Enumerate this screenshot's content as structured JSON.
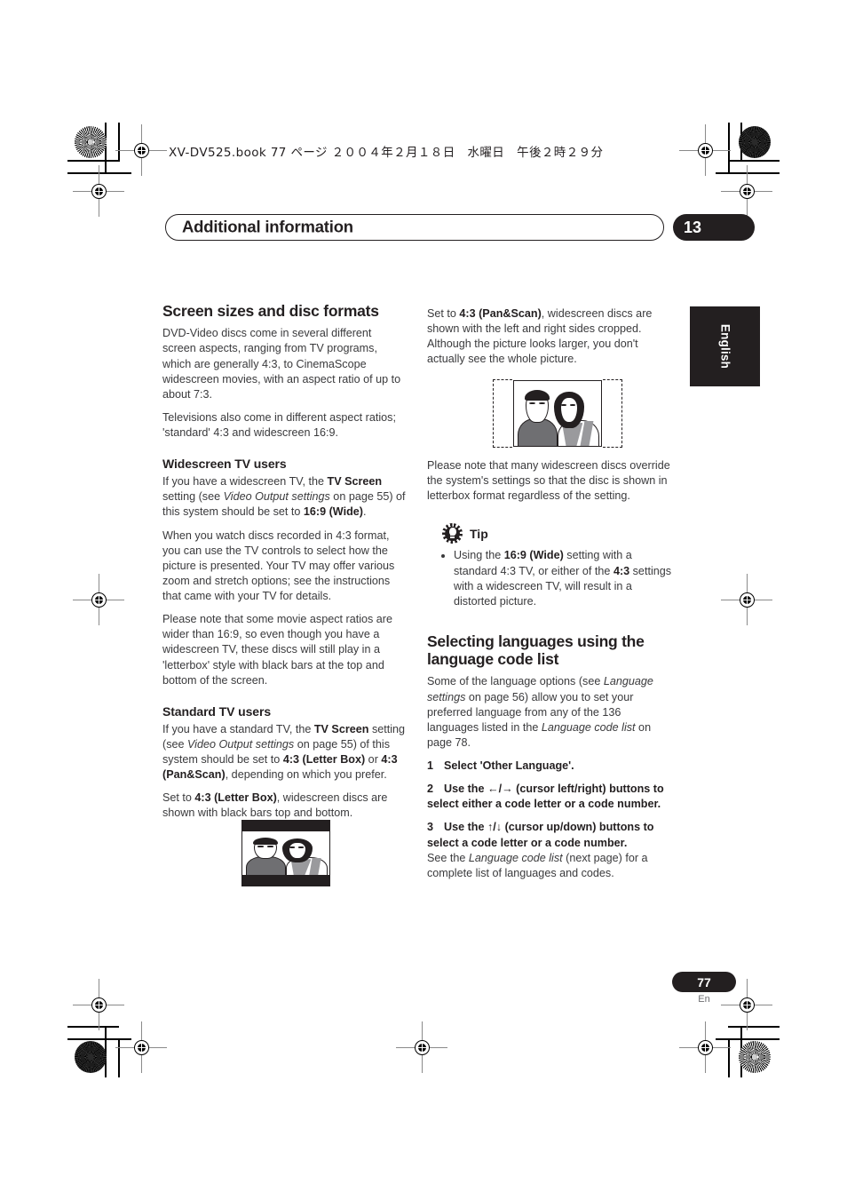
{
  "print_meta": {
    "file_line": "XV-DV525.book  77 ページ  ２００４年２月１８日　水曜日　午後２時２９分"
  },
  "header": {
    "chapter_title": "Additional information",
    "chapter_number": "13"
  },
  "side_tab": {
    "label": "English"
  },
  "left_column": {
    "heading": "Screen sizes and disc formats",
    "intro_p1": "DVD-Video discs come in several different screen aspects, ranging from TV programs, which are generally 4:3, to CinemaScope widescreen movies, with an aspect ratio of up to about 7:3.",
    "intro_p2": "Televisions also come in different aspect ratios; 'standard' 4:3 and widescreen 16:9.",
    "widescreen_heading": "Widescreen TV users",
    "ws_p1_a": "If you have a widescreen TV, the ",
    "ws_p1_b": "TV Screen",
    "ws_p1_c": " setting (see ",
    "ws_p1_italic": "Video Output settings",
    "ws_p1_d": " on page 55) of this system should be set to ",
    "ws_p1_e": "16:9 (Wide)",
    "ws_p1_f": ".",
    "ws_p2": "When you watch discs recorded in 4:3 format, you can use the TV controls to select how the picture is presented. Your TV may offer various zoom and stretch options; see the instructions that came with your TV for details.",
    "ws_p3": "Please note that some movie aspect ratios are wider than 16:9, so even though you have a widescreen TV, these discs will still play in a 'letterbox' style with black bars at the top and bottom of the screen.",
    "standard_heading": "Standard TV users",
    "std_p1_a": "If you have a standard TV, the ",
    "std_p1_b": "TV Screen",
    "std_p1_c": " setting (see ",
    "std_p1_italic": "Video Output settings",
    "std_p1_d": " on page 55) of this system should be set to ",
    "std_p1_e": "4:3 (Letter Box)",
    "std_p1_f": " or ",
    "std_p1_g": "4:3 (Pan&Scan)",
    "std_p1_h": ", depending on which you prefer.",
    "std_p2_a": "Set to ",
    "std_p2_b": "4:3 (Letter Box)",
    "std_p2_c": ", widescreen discs are shown with black bars top and bottom.",
    "figure_caption": "letterbox-tv-illustration"
  },
  "right_column": {
    "panscan_p_a": "Set to ",
    "panscan_p_b": "4:3 (Pan&Scan)",
    "panscan_p_c": ", widescreen discs are shown with the left and right sides cropped. Although the picture looks larger, you don't actually see the whole picture.",
    "figure_caption": "panscan-tv-illustration",
    "note_p": "Please note that many widescreen discs override the system's settings so that the disc is shown in letterbox format regardless of the setting.",
    "tip_label": "Tip",
    "tip_items": [
      {
        "a": "Using the ",
        "b": "16:9 (Wide)",
        "c": " setting with a standard 4:3 TV, or either of the ",
        "d": "4:3",
        "e": " settings with a widescreen TV, will result in a distorted picture."
      }
    ],
    "lang_heading": "Selecting languages using the language code list",
    "lang_p_a": "Some of the language options (see ",
    "lang_p_italic1": "Language settings",
    "lang_p_b": " on page 56) allow you to set your preferred language from any of the 136 languages listed in the ",
    "lang_p_italic2": "Language code list",
    "lang_p_c": " on page 78.",
    "steps": [
      {
        "num": "1",
        "text": "Select 'Other Language'.",
        "after": ""
      },
      {
        "num": "2",
        "text": "Use the ←/→ (cursor left/right) buttons to select either a code letter or a code number.",
        "after": ""
      },
      {
        "num": "3",
        "text": "Use the ↑/↓ (cursor up/down) buttons to select a code letter or a code number.",
        "after_a": "See the ",
        "after_italic": "Language code list",
        "after_b": " (next page) for a complete list of languages and codes."
      }
    ]
  },
  "footer": {
    "page_number": "77",
    "language_code": "En"
  },
  "colors": {
    "ink": "#231f20",
    "body_text": "#3a3a3c",
    "mid_gray": "#6f6f72",
    "light_gray": "#9a9a9d"
  }
}
